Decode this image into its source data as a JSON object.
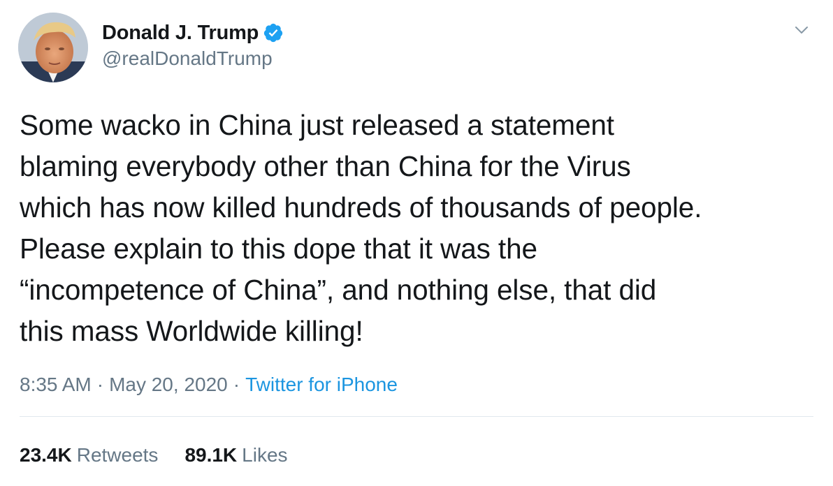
{
  "author": {
    "display_name": "Donald J. Trump",
    "handle": "@realDonaldTrump",
    "verified": true
  },
  "tweet": {
    "text": "Some wacko in China just released a statement\nblaming everybody other than China for the Virus\nwhich has now killed hundreds of thousands of people.\nPlease explain to this dope that it was the\n“incompetence of China”, and nothing else, that did\nthis mass Worldwide killing!",
    "time": "8:35 AM",
    "separator": "·",
    "date": "May 20, 2020",
    "source": "Twitter for iPhone"
  },
  "stats": {
    "retweets_count": "23.4K",
    "retweets_label": "Retweets",
    "likes_count": "89.1K",
    "likes_label": "Likes"
  },
  "icons": {
    "verified": "verified-badge-icon",
    "menu": "chevron-down-icon"
  },
  "colors": {
    "text": "#14171a",
    "secondary": "#657786",
    "link": "#1b95e0",
    "verified": "#1da1f2",
    "divider": "#e1e8ed"
  }
}
